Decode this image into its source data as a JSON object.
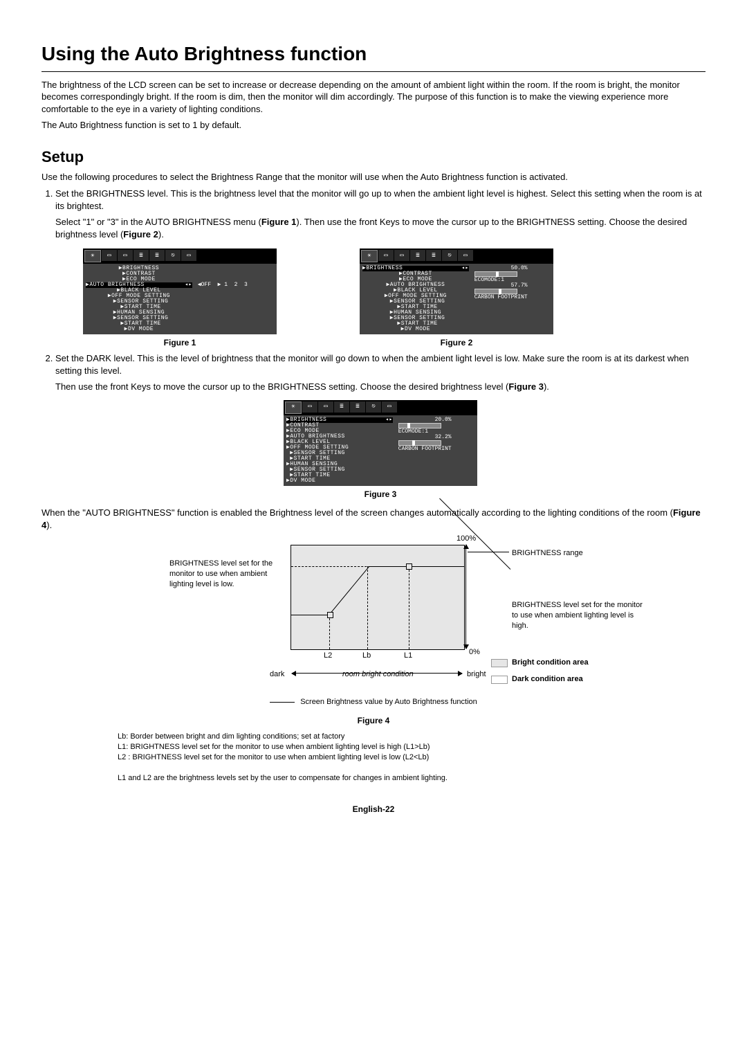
{
  "title": "Using the Auto Brightness function",
  "intro1": "The brightness of the LCD screen can be set to increase or decrease depending on the amount of ambient light within the room. If the room is bright, the monitor becomes correspondingly bright. If the room is dim, then the monitor will dim accordingly. The purpose of this function is to make the viewing experience more comfortable to the eye in a variety of lighting conditions.",
  "intro2": "The Auto Brightness function is set to 1 by default.",
  "setup_heading": "Setup",
  "setup_intro": "Use the following procedures to select the Brightness Range that the monitor will use when the Auto Brightness function is activated.",
  "step1a": "Set the BRIGHTNESS level. This is the brightness level that the monitor will go up to when the ambient light level is highest. Select this setting when the room is at its brightest.",
  "step1b_pre": "Select \"1\" or \"3\" in the AUTO BRIGHTNESS menu (",
  "step1b_fig1": "Figure 1",
  "step1b_mid": "). Then use the front Keys to move the cursor up to the BRIGHTNESS setting. Choose the desired brightness level (",
  "step1b_fig2": "Figure 2",
  "step1b_end": ").",
  "fig1_caption": "Figure 1",
  "fig2_caption": "Figure 2",
  "step2a": "Set the DARK level. This is the level of brightness that the monitor will go down to when the ambient light level is low. Make sure the room is at its darkest when setting this level.",
  "step2b_pre": "Then use the front Keys to move the cursor up to the BRIGHTNESS setting. Choose the desired brightness level (",
  "step2b_fig3": "Figure 3",
  "step2b_end": ").",
  "fig3_caption": "Figure 3",
  "auto_para_pre": "When the \"AUTO BRIGHTNESS\" function is enabled the Brightness level of the screen changes automatically according to the lighting conditions of the room (",
  "auto_para_fig4": "Figure 4",
  "auto_para_end": ").",
  "fig4_caption": "Figure 4",
  "diagram": {
    "top_pct": "100%",
    "bottom_pct": "0%",
    "left_label": "BRIGHTNESS level set for the monitor to use when ambient lighting level is low.",
    "right_range": "BRIGHTNESS range",
    "right_high": "BRIGHTNESS level set for the monitor to use when ambient lighting level is high.",
    "l2": "L2",
    "lb": "Lb",
    "l1": "L1",
    "dark": "dark",
    "bright": "bright",
    "room": "room bright condition",
    "bright_area": "Bright condition area",
    "dark_area": "Dark condition area",
    "legend": "Screen Brightness value by Auto Brightness function"
  },
  "notes": {
    "lb": "Lb: Border between bright and dim lighting conditions; set at factory",
    "l1": "L1: BRIGHTNESS level set for the monitor to use when ambient lighting level is high (L1>Lb)",
    "l2": "L2 : BRIGHTNESS level set for the monitor to use when ambient lighting level is low (L2<Lb)",
    "final": "L1 and L2 are the brightness levels set by the user to compensate for changes in ambient lighting."
  },
  "footer": "English-22",
  "osd_menu_items": [
    "▶BRIGHTNESS",
    "▶CONTRAST",
    "▶ECO MODE",
    "▶AUTO BRIGHTNESS",
    "▶BLACK LEVEL",
    "▶OFF MODE SETTING",
    " ▶SENSOR SETTING",
    " ▶START TIME",
    "▶HUMAN SENSING",
    " ▶SENSOR SETTING",
    " ▶START TIME",
    "▶DV MODE"
  ],
  "osd_fig1_right": "◀OFF  ▶ 1  2  3",
  "osd_fig2": {
    "brightness": "50.0%",
    "ecomode": "ECOMODE:1",
    "pct2": "57.7%",
    "carbon": "CARBON FOOTPRINT"
  },
  "osd_fig3": {
    "brightness": "20.0%",
    "ecomode": "ECOMODE:1",
    "pct2": "32.2%",
    "carbon": "CARBON FOOTPRINT"
  }
}
